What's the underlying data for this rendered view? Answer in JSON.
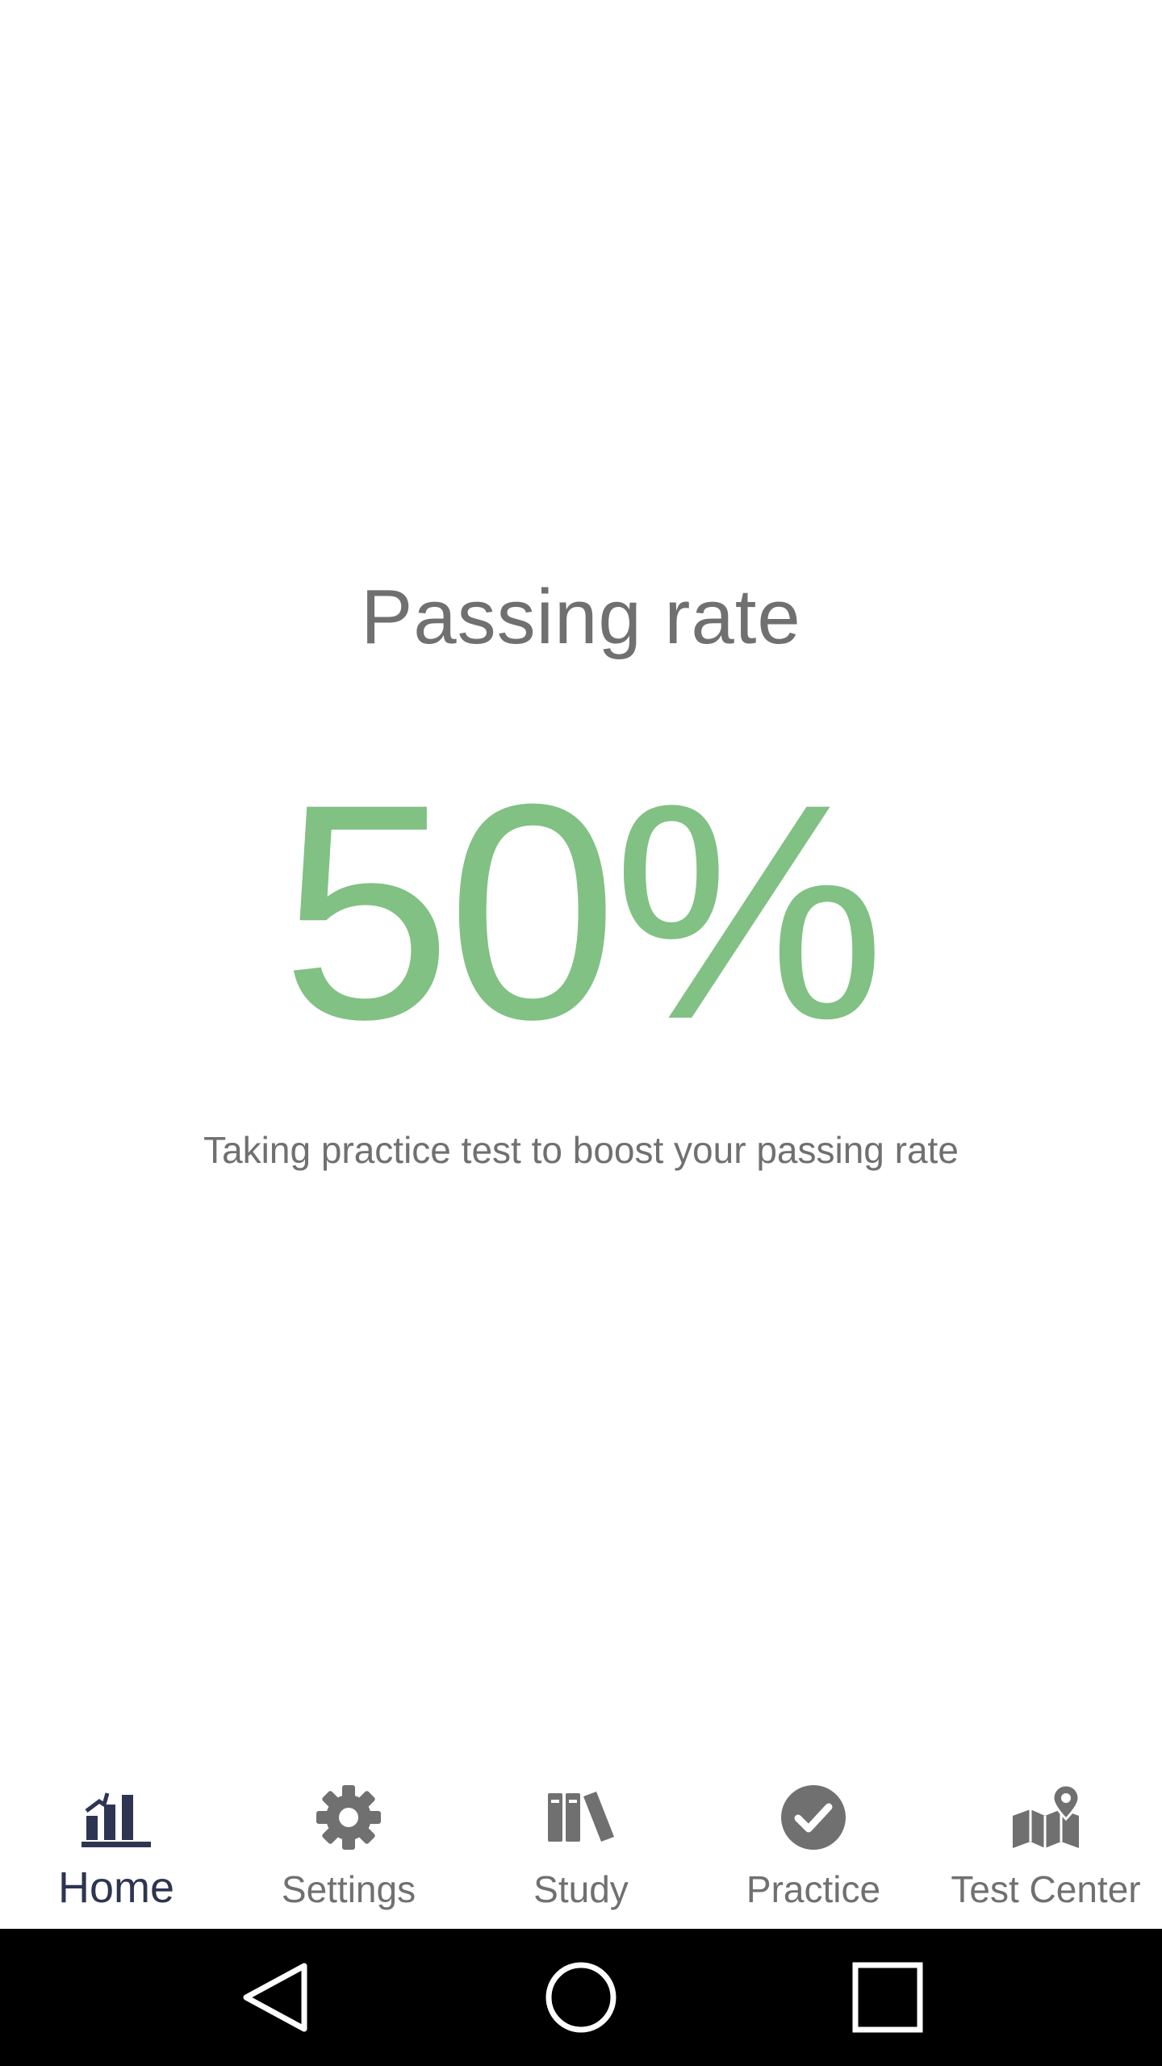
{
  "main": {
    "title": "Passing rate",
    "rate": "50%",
    "subtitle": "Taking practice test to boost your passing rate",
    "rate_color": "#81c184"
  },
  "tabs": [
    {
      "label": "Home",
      "icon": "bar-chart-icon",
      "active": true
    },
    {
      "label": "Settings",
      "icon": "gear-icon",
      "active": false
    },
    {
      "label": "Study",
      "icon": "books-icon",
      "active": false
    },
    {
      "label": "Practice",
      "icon": "check-circle-icon",
      "active": false
    },
    {
      "label": "Test Center",
      "icon": "map-pin-icon",
      "active": false
    }
  ],
  "colors": {
    "active_tab": "#2e3552",
    "inactive_tab": "#707070",
    "system_nav": "#000000"
  },
  "system_nav": {
    "buttons": [
      "back-icon",
      "home-circle-icon",
      "recents-square-icon"
    ]
  }
}
